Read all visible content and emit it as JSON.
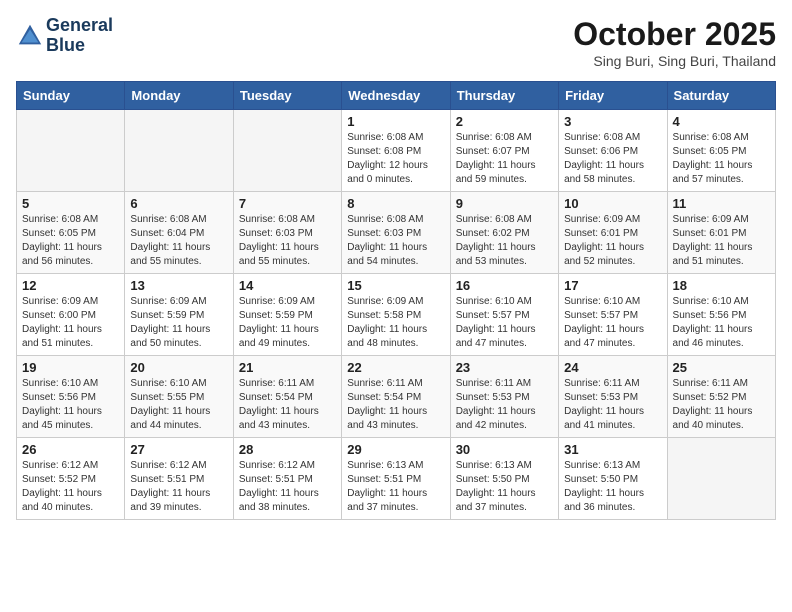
{
  "header": {
    "logo_line1": "General",
    "logo_line2": "Blue",
    "month": "October 2025",
    "location": "Sing Buri, Sing Buri, Thailand"
  },
  "weekdays": [
    "Sunday",
    "Monday",
    "Tuesday",
    "Wednesday",
    "Thursday",
    "Friday",
    "Saturday"
  ],
  "weeks": [
    [
      {
        "day": "",
        "info": ""
      },
      {
        "day": "",
        "info": ""
      },
      {
        "day": "",
        "info": ""
      },
      {
        "day": "1",
        "info": "Sunrise: 6:08 AM\nSunset: 6:08 PM\nDaylight: 12 hours\nand 0 minutes."
      },
      {
        "day": "2",
        "info": "Sunrise: 6:08 AM\nSunset: 6:07 PM\nDaylight: 11 hours\nand 59 minutes."
      },
      {
        "day": "3",
        "info": "Sunrise: 6:08 AM\nSunset: 6:06 PM\nDaylight: 11 hours\nand 58 minutes."
      },
      {
        "day": "4",
        "info": "Sunrise: 6:08 AM\nSunset: 6:05 PM\nDaylight: 11 hours\nand 57 minutes."
      }
    ],
    [
      {
        "day": "5",
        "info": "Sunrise: 6:08 AM\nSunset: 6:05 PM\nDaylight: 11 hours\nand 56 minutes."
      },
      {
        "day": "6",
        "info": "Sunrise: 6:08 AM\nSunset: 6:04 PM\nDaylight: 11 hours\nand 55 minutes."
      },
      {
        "day": "7",
        "info": "Sunrise: 6:08 AM\nSunset: 6:03 PM\nDaylight: 11 hours\nand 55 minutes."
      },
      {
        "day": "8",
        "info": "Sunrise: 6:08 AM\nSunset: 6:03 PM\nDaylight: 11 hours\nand 54 minutes."
      },
      {
        "day": "9",
        "info": "Sunrise: 6:08 AM\nSunset: 6:02 PM\nDaylight: 11 hours\nand 53 minutes."
      },
      {
        "day": "10",
        "info": "Sunrise: 6:09 AM\nSunset: 6:01 PM\nDaylight: 11 hours\nand 52 minutes."
      },
      {
        "day": "11",
        "info": "Sunrise: 6:09 AM\nSunset: 6:01 PM\nDaylight: 11 hours\nand 51 minutes."
      }
    ],
    [
      {
        "day": "12",
        "info": "Sunrise: 6:09 AM\nSunset: 6:00 PM\nDaylight: 11 hours\nand 51 minutes."
      },
      {
        "day": "13",
        "info": "Sunrise: 6:09 AM\nSunset: 5:59 PM\nDaylight: 11 hours\nand 50 minutes."
      },
      {
        "day": "14",
        "info": "Sunrise: 6:09 AM\nSunset: 5:59 PM\nDaylight: 11 hours\nand 49 minutes."
      },
      {
        "day": "15",
        "info": "Sunrise: 6:09 AM\nSunset: 5:58 PM\nDaylight: 11 hours\nand 48 minutes."
      },
      {
        "day": "16",
        "info": "Sunrise: 6:10 AM\nSunset: 5:57 PM\nDaylight: 11 hours\nand 47 minutes."
      },
      {
        "day": "17",
        "info": "Sunrise: 6:10 AM\nSunset: 5:57 PM\nDaylight: 11 hours\nand 47 minutes."
      },
      {
        "day": "18",
        "info": "Sunrise: 6:10 AM\nSunset: 5:56 PM\nDaylight: 11 hours\nand 46 minutes."
      }
    ],
    [
      {
        "day": "19",
        "info": "Sunrise: 6:10 AM\nSunset: 5:56 PM\nDaylight: 11 hours\nand 45 minutes."
      },
      {
        "day": "20",
        "info": "Sunrise: 6:10 AM\nSunset: 5:55 PM\nDaylight: 11 hours\nand 44 minutes."
      },
      {
        "day": "21",
        "info": "Sunrise: 6:11 AM\nSunset: 5:54 PM\nDaylight: 11 hours\nand 43 minutes."
      },
      {
        "day": "22",
        "info": "Sunrise: 6:11 AM\nSunset: 5:54 PM\nDaylight: 11 hours\nand 43 minutes."
      },
      {
        "day": "23",
        "info": "Sunrise: 6:11 AM\nSunset: 5:53 PM\nDaylight: 11 hours\nand 42 minutes."
      },
      {
        "day": "24",
        "info": "Sunrise: 6:11 AM\nSunset: 5:53 PM\nDaylight: 11 hours\nand 41 minutes."
      },
      {
        "day": "25",
        "info": "Sunrise: 6:11 AM\nSunset: 5:52 PM\nDaylight: 11 hours\nand 40 minutes."
      }
    ],
    [
      {
        "day": "26",
        "info": "Sunrise: 6:12 AM\nSunset: 5:52 PM\nDaylight: 11 hours\nand 40 minutes."
      },
      {
        "day": "27",
        "info": "Sunrise: 6:12 AM\nSunset: 5:51 PM\nDaylight: 11 hours\nand 39 minutes."
      },
      {
        "day": "28",
        "info": "Sunrise: 6:12 AM\nSunset: 5:51 PM\nDaylight: 11 hours\nand 38 minutes."
      },
      {
        "day": "29",
        "info": "Sunrise: 6:13 AM\nSunset: 5:51 PM\nDaylight: 11 hours\nand 37 minutes."
      },
      {
        "day": "30",
        "info": "Sunrise: 6:13 AM\nSunset: 5:50 PM\nDaylight: 11 hours\nand 37 minutes."
      },
      {
        "day": "31",
        "info": "Sunrise: 6:13 AM\nSunset: 5:50 PM\nDaylight: 11 hours\nand 36 minutes."
      },
      {
        "day": "",
        "info": ""
      }
    ]
  ]
}
